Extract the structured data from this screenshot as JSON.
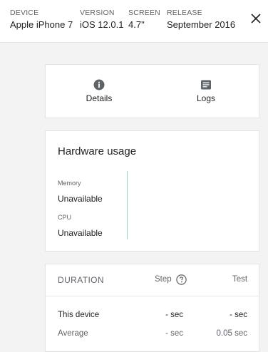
{
  "header": {
    "device": {
      "label": "DEVICE",
      "value": "Apple iPhone 7"
    },
    "version": {
      "label": "VERSION",
      "value": "iOS 12.0.1"
    },
    "screen": {
      "label": "SCREEN",
      "value": "4.7\""
    },
    "release": {
      "label": "RELEASE",
      "value": "September 2016"
    },
    "close_icon": "close-icon"
  },
  "tabs": [
    {
      "label": "Details",
      "icon": "info-icon"
    },
    {
      "label": "Logs",
      "icon": "logs-icon"
    }
  ],
  "hardware": {
    "title": "Hardware usage",
    "metrics": [
      {
        "label": "Memory",
        "value": "Unavailable"
      },
      {
        "label": "CPU",
        "value": "Unavailable"
      }
    ]
  },
  "duration": {
    "title": "DURATION",
    "columns": {
      "step": "Step",
      "test": "Test"
    },
    "help_icon": "help-circle-icon",
    "rows": [
      {
        "label": "This device",
        "step": "- sec",
        "test": "- sec"
      },
      {
        "label": "Average",
        "step": "- sec",
        "test": "0.05 sec"
      }
    ]
  },
  "colors": {
    "background": "#f3f3f3",
    "card": "#ffffff",
    "divider_accent": "#a9c9c2",
    "icon": "#5f6368",
    "muted_text": "#5f6368",
    "primary_text": "#202124"
  }
}
